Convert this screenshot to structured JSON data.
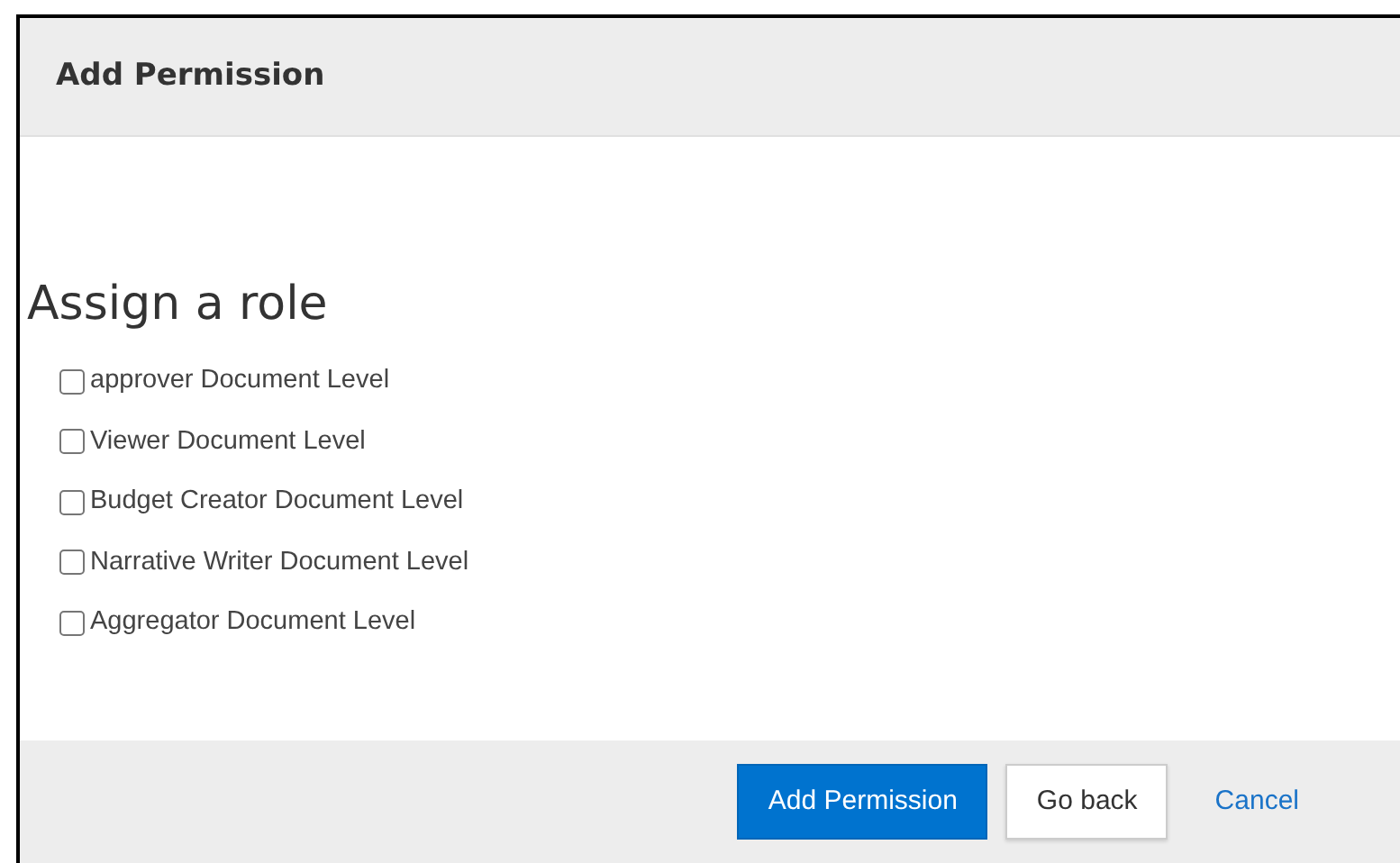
{
  "dialog": {
    "title": "Add Permission"
  },
  "heading": "Assign a role",
  "roles": [
    {
      "label": "approver Document Level",
      "checked": false
    },
    {
      "label": "Viewer Document Level",
      "checked": false
    },
    {
      "label": "Budget Creator Document Level",
      "checked": false
    },
    {
      "label": "Narrative Writer Document Level",
      "checked": false
    },
    {
      "label": "Aggregator Document Level",
      "checked": false
    }
  ],
  "buttons": [
    {
      "label": "Add Permission",
      "kind": "primary"
    },
    {
      "label": "Go back",
      "kind": "secondary"
    },
    {
      "label": "Cancel",
      "kind": "link"
    }
  ]
}
